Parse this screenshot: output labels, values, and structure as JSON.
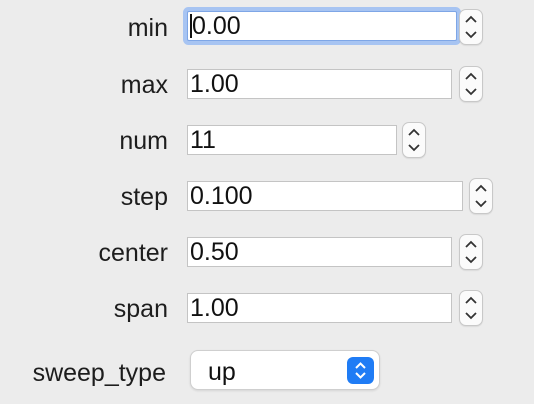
{
  "fields": [
    {
      "label": "min",
      "value": "0.00"
    },
    {
      "label": "max",
      "value": "1.00"
    },
    {
      "label": "num",
      "value": "11"
    },
    {
      "label": "step",
      "value": "0.100"
    },
    {
      "label": "center",
      "value": "0.50"
    },
    {
      "label": "span",
      "value": "1.00"
    }
  ],
  "sweep_type": {
    "label": "sweep_type",
    "value": "up"
  },
  "colors": {
    "background": "#ececec",
    "focus_ring": "#a7c4f2",
    "accent": "#1f7cf5"
  },
  "icons": {
    "stepper_up": "chevron-up-icon",
    "stepper_down": "chevron-down-icon",
    "select_arrows": "updown-arrows-icon"
  }
}
